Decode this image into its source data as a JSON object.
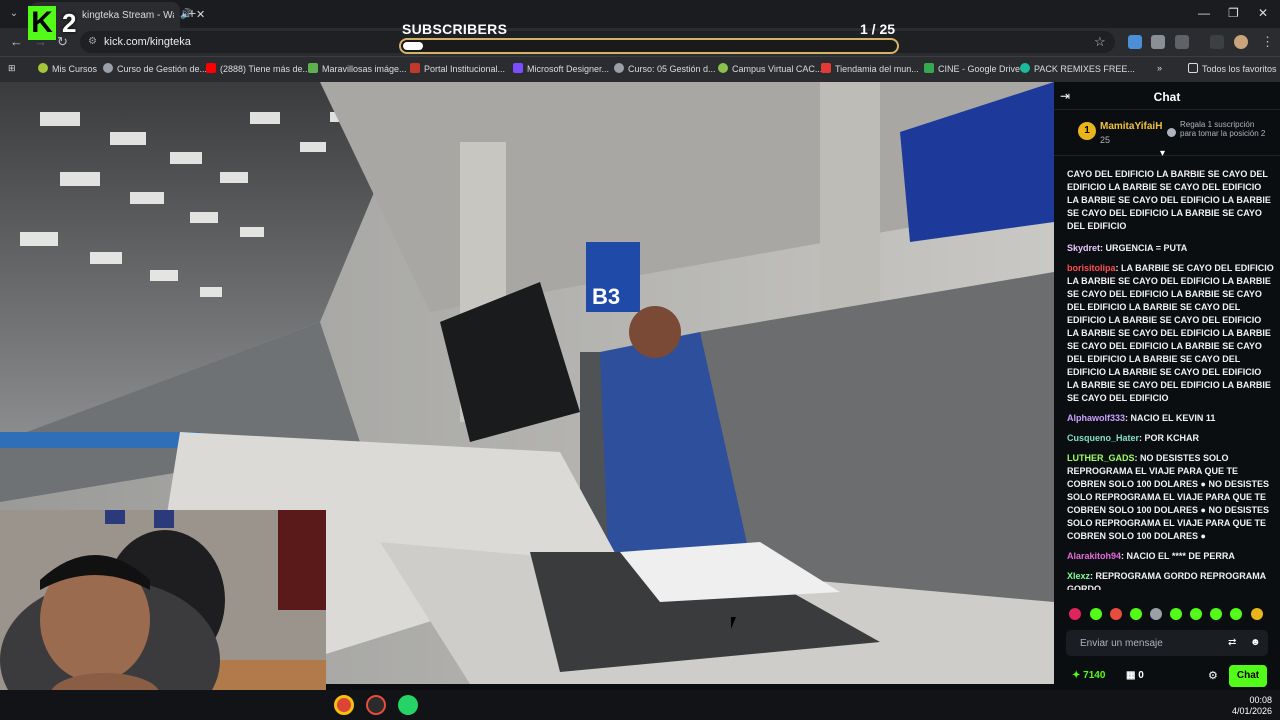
{
  "browser": {
    "tab_title": "kingteka Stream - Watch Li",
    "url": "kick.com/kingteka",
    "bookmarks": [
      {
        "label": "Mis Cursos",
        "color": "#a4c639"
      },
      {
        "label": "Curso de Gestión de...",
        "color": "#9aa0a6"
      },
      {
        "label": "(2888) Tiene más de...",
        "color": "#ff0000"
      },
      {
        "label": "Maravillosas imáge...",
        "color": "#5fb04f"
      },
      {
        "label": "Portal Institucional...",
        "color": "#c0392b"
      },
      {
        "label": "Microsoft Designer...",
        "color": "#7b4dff"
      },
      {
        "label": "Curso: 05 Gestión d...",
        "color": "#9aa0a6"
      },
      {
        "label": "Campus Virtual CAC...",
        "color": "#8bc34a"
      },
      {
        "label": "Tiendamia del mun...",
        "color": "#e53935"
      },
      {
        "label": "CINE - Google Drive",
        "color": "#34a853"
      },
      {
        "label": "PACK REMIXES FREE...",
        "color": "#1abc9c"
      }
    ],
    "all_favorites": "Todos los favoritos"
  },
  "overlay": {
    "logo_letter": "K",
    "logo_number": "2",
    "subscribers_label": "SUBSCRIBERS",
    "subscribers_count": "1  / 25",
    "subscribers_progress": 0.04
  },
  "chat": {
    "title": "Chat",
    "pinned": {
      "rank": "1",
      "user": "MamitaYifaiH",
      "count": "25",
      "gift_text": "Regala 1 suscripción para tomar la posición 2"
    },
    "messages": [
      {
        "user": "",
        "color": "#ffffff",
        "text": "CAYO DEL EDIFICIO LA BARBIE SE CAYO DEL EDIFICIO LA BARBIE SE CAYO DEL EDIFICIO LA BARBIE SE CAYO DEL EDIFICIO LA BARBIE SE CAYO DEL EDIFICIO LA BARBIE SE CAYO DEL EDIFICIO"
      },
      {
        "user": "Skydret",
        "color": "#e8c9ff",
        "text": "URGENCIA = PUTA"
      },
      {
        "user": "borisitolipa",
        "color": "#ff4d4d",
        "text": "LA BARBIE SE CAYO DEL EDIFICIO LA BARBIE SE CAYO DEL EDIFICIO LA BARBIE SE CAYO DEL EDIFICIO LA BARBIE SE CAYO DEL EDIFICIO LA BARBIE SE CAYO DEL EDIFICIO LA BARBIE SE CAYO DEL EDIFICIO LA BARBIE SE CAYO DEL EDIFICIO LA BARBIE SE CAYO DEL EDIFICIO LA BARBIE SE CAYO DEL EDIFICIO LA BARBIE SE CAYO DEL EDIFICIO LA BARBIE SE CAYO DEL EDIFICIO LA BARBIE SE CAYO DEL EDIFICIO LA BARBIE SE CAYO DEL EDIFICIO"
      },
      {
        "user": "Alphawolf333",
        "color": "#c9a0ff",
        "text": "NACIO EL KEVIN 11"
      },
      {
        "user": "Cusqueno_Hater",
        "color": "#7ee0c5",
        "text": "POR KCHAR"
      },
      {
        "user": "LUTHER_GADS",
        "color": "#9cff66",
        "text": "NO DESISTES SOLO REPROGRAMA EL VIAJE PARA QUE TE COBREN SOLO 100 DOLARES ● NO DESISTES SOLO REPROGRAMA EL VIAJE PARA QUE TE COBREN SOLO 100 DOLARES ● NO DESISTES SOLO REPROGRAMA EL VIAJE PARA QUE TE COBREN SOLO 100 DOLARES ●"
      },
      {
        "user": "Alarakitoh94",
        "color": "#e36bd9",
        "text": "NACIO EL **** DE PERRA"
      },
      {
        "user": "Xlexz",
        "color": "#7dff9a",
        "text": "REPROGRAMA GORDO REPROGRAMA GORDO"
      }
    ],
    "input_placeholder": "Enviar un mensaje",
    "points": "7140",
    "zero_count": "0",
    "chat_button": "Chat"
  },
  "taskbar": {
    "time": "00:08",
    "date": "4/01/2026"
  }
}
